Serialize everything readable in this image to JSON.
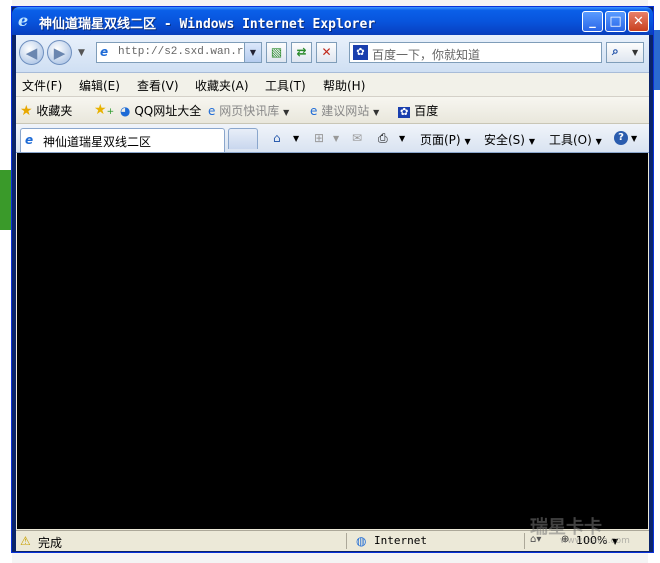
{
  "window": {
    "title": "神仙道瑞星双线二区 - Windows Internet Explorer",
    "minimize_symbol": "_",
    "maximize_symbol": "□",
    "close_symbol": "✕"
  },
  "navbar": {
    "back_symbol": "◀",
    "forward_symbol": "▶",
    "address_value": "http://s2.sxd.wan.r.",
    "search_placeholder": "百度一下，你就知道"
  },
  "menubar": {
    "items": [
      "文件(F)",
      "编辑(E)",
      "查看(V)",
      "收藏夹(A)",
      "工具(T)",
      "帮助(H)"
    ]
  },
  "favorites_bar": {
    "favorites_label": "收藏夹",
    "links": [
      "QQ网址大全",
      "网页快讯库",
      "建议网站",
      "百度"
    ]
  },
  "tabs": {
    "active_tab_title": "神仙道瑞星双线二区"
  },
  "command_bar": {
    "page_label": "页面(P)",
    "safety_label": "安全(S)",
    "tools_label": "工具(O)"
  },
  "status_bar": {
    "status_text": "完成",
    "zone_text": "Internet",
    "zoom_text": "100%"
  },
  "background": {
    "watermark": "瑞星卡卡",
    "watermark_url": "www.ikaka.com"
  },
  "colors": {
    "titlebar": "#0855dd",
    "content": "#000000"
  }
}
